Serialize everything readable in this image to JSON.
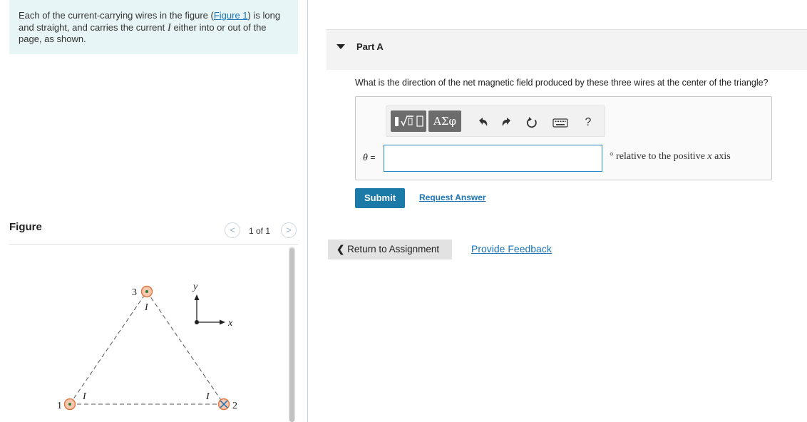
{
  "intro": {
    "text_before": "Each of the current-carrying wires in the figure (",
    "figure_link": "Figure 1",
    "text_mid": ") is long and straight, and carries the current ",
    "current_symbol": "I",
    "text_after": " either into or out of the page, as shown."
  },
  "figure_panel": {
    "title": "Figure",
    "prev_label": "<",
    "next_label": ">",
    "pager_text": "1 of 1",
    "diagram": {
      "wire_labels": [
        "1",
        "2",
        "3"
      ],
      "current_label": "I",
      "axis_x": "x",
      "axis_y": "y"
    }
  },
  "part": {
    "label": "Part A",
    "question": "What is the direction of the net magnetic field produced by these three wires at the center of the triangle?",
    "toolbar": {
      "templates_icon": "templates-icon",
      "symbols_label": "ΑΣφ",
      "undo_icon": "undo-icon",
      "redo_icon": "redo-icon",
      "reset_icon": "reset-icon",
      "keyboard_icon": "keyboard-icon",
      "help_label": "?"
    },
    "variable": "θ",
    "equals": "=",
    "input_value": "",
    "units_degree": "°",
    "units_text": "relative to the positive",
    "units_axis": "x",
    "units_end": "axis",
    "submit_label": "Submit",
    "request_answer_label": "Request Answer"
  },
  "footer": {
    "return_label": "Return to Assignment",
    "feedback_label": "Provide Feedback"
  },
  "colors": {
    "accent": "#1b7aa8",
    "link": "#1b73b8",
    "intro_bg": "#e8f5f6",
    "wire_fill": "#f3c7b0",
    "wire_stroke": "#e07b45"
  }
}
